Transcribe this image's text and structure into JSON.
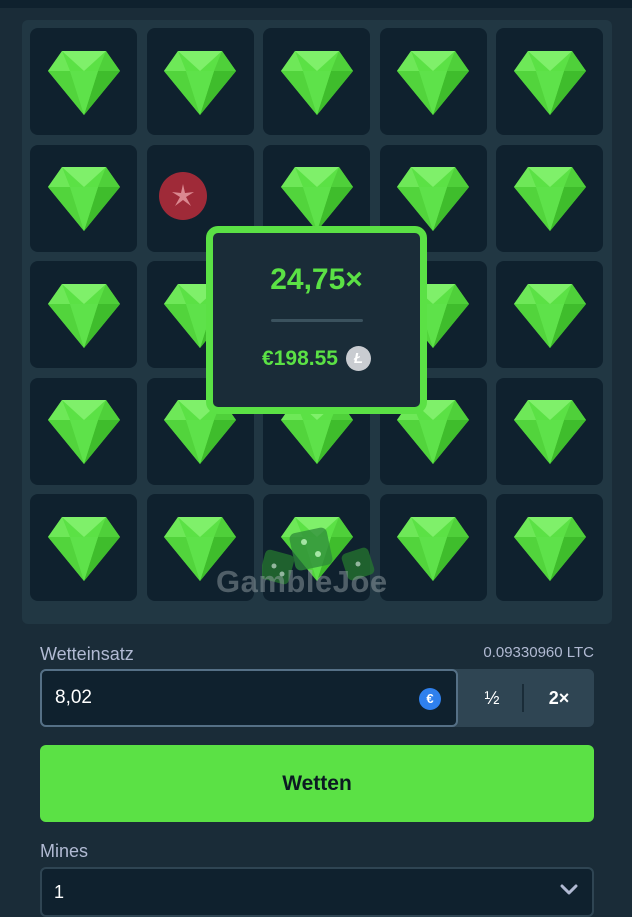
{
  "game": {
    "name": "Mines",
    "tiles": [
      "gem",
      "gem",
      "gem",
      "gem",
      "gem",
      "gem",
      "mine",
      "gem",
      "gem",
      "gem",
      "gem",
      "gem",
      "gem",
      "gem",
      "gem",
      "gem",
      "gem",
      "gem",
      "gem",
      "gem",
      "gem",
      "gem",
      "gem",
      "gem",
      "gem"
    ],
    "colors": {
      "gem": "#5be145",
      "mine": "#d02d3c",
      "accent": "#5be145"
    }
  },
  "win_popup": {
    "multiplier": "24,75×",
    "payout": "€198.55",
    "currency_icon": "litecoin-icon"
  },
  "watermark": {
    "text": "GambleJoe"
  },
  "bet": {
    "label": "Wetteinsatz",
    "balance": "0.09330960 LTC",
    "amount": "8,02",
    "currency_icon": "euro-icon",
    "half_label": "½",
    "double_label": "2×",
    "submit_label": "Wetten"
  },
  "mines": {
    "label": "Mines",
    "selected": "1"
  }
}
